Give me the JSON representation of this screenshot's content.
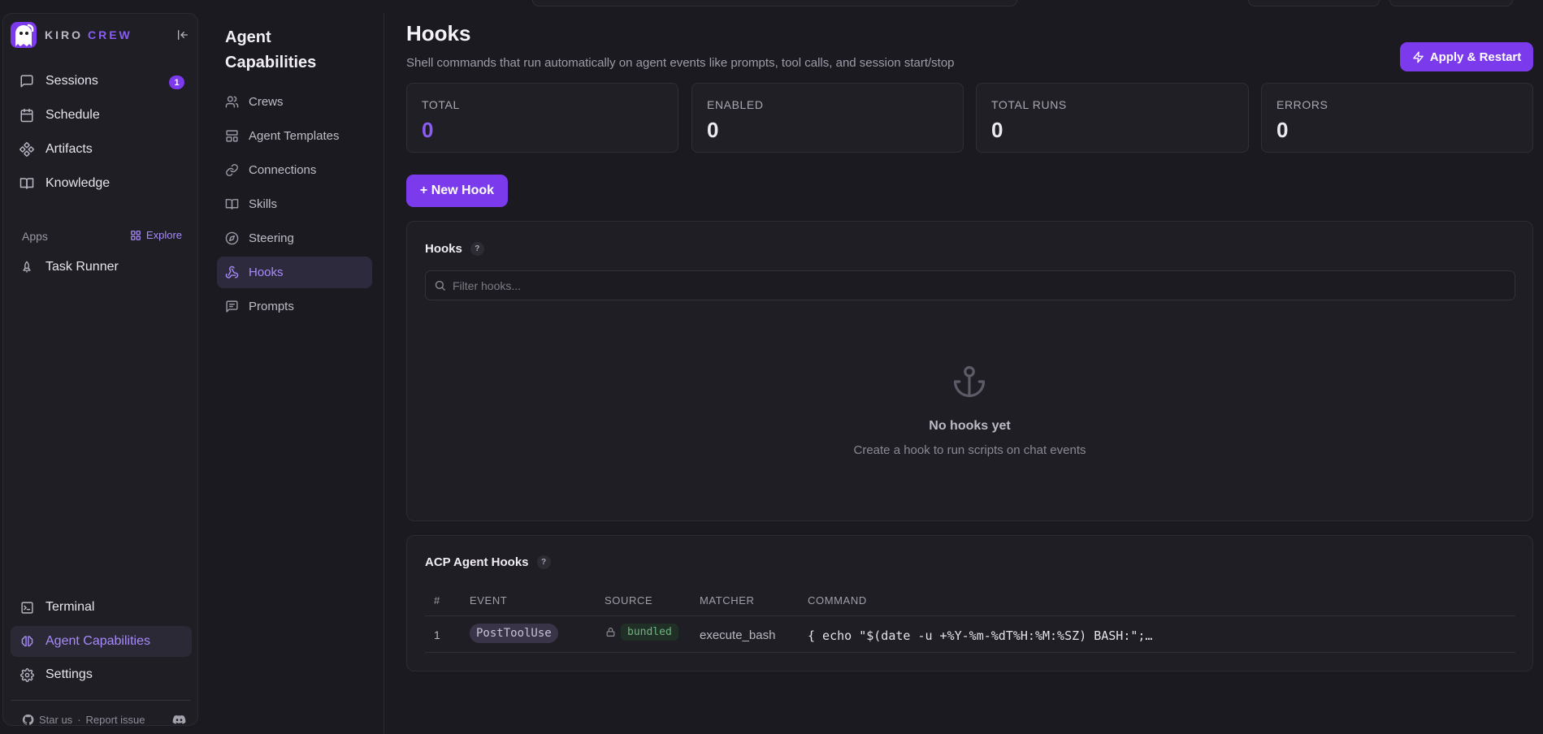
{
  "brand": {
    "word1": "KIRO",
    "word2": "CREW"
  },
  "sidebar": {
    "items": [
      {
        "label": "Sessions",
        "badge": "1"
      },
      {
        "label": "Schedule"
      },
      {
        "label": "Artifacts"
      },
      {
        "label": "Knowledge"
      }
    ],
    "apps_label": "Apps",
    "explore_label": "Explore",
    "apps": [
      {
        "label": "Task Runner"
      }
    ],
    "bottom": [
      {
        "label": "Terminal"
      },
      {
        "label": "Agent Capabilities"
      },
      {
        "label": "Settings"
      }
    ],
    "footer": {
      "star": "Star us",
      "separator": "·",
      "report": "Report issue"
    }
  },
  "capabilities": {
    "title": "Agent Capabilities",
    "items": [
      {
        "label": "Crews"
      },
      {
        "label": "Agent Templates"
      },
      {
        "label": "Connections"
      },
      {
        "label": "Skills"
      },
      {
        "label": "Steering"
      },
      {
        "label": "Hooks"
      },
      {
        "label": "Prompts"
      }
    ]
  },
  "header": {
    "title": "Hooks",
    "subtitle": "Shell commands that run automatically on agent events like prompts, tool calls, and session start/stop",
    "apply_label": "Apply & Restart"
  },
  "stats": [
    {
      "label": "TOTAL",
      "value": "0"
    },
    {
      "label": "ENABLED",
      "value": "0"
    },
    {
      "label": "TOTAL RUNS",
      "value": "0"
    },
    {
      "label": "ERRORS",
      "value": "0"
    }
  ],
  "new_hook_label": "+ New Hook",
  "hooks_panel": {
    "title": "Hooks",
    "help": "?",
    "filter_placeholder": "Filter hooks...",
    "empty_title": "No hooks yet",
    "empty_subtitle": "Create a hook to run scripts on chat events"
  },
  "acp_panel": {
    "title": "ACP Agent Hooks",
    "help": "?",
    "columns": [
      "#",
      "EVENT",
      "SOURCE",
      "MATCHER",
      "COMMAND"
    ],
    "rows": [
      {
        "num": "1",
        "event": "PostToolUse",
        "source": "bundled",
        "matcher": "execute_bash",
        "command": "{ echo \"$(date -u +%Y-%m-%dT%H:%M:%SZ) BASH:\";…"
      }
    ]
  },
  "colors": {
    "accent": "#7c3aed",
    "accent_text": "#a78bfa",
    "background": "#1b1a20",
    "source_green": "#6fb47f"
  },
  "icons": {
    "sidebar": [
      "chat-bubble-icon",
      "calendar-icon",
      "artifacts-icon",
      "book-icon",
      "rocket-icon",
      "terminal-icon",
      "brain-icon",
      "gear-icon"
    ],
    "capabilities": [
      "users-icon",
      "template-icon",
      "link-icon",
      "book-icon",
      "compass-icon",
      "webhook-icon",
      "message-square-icon"
    ],
    "misc": [
      "collapse-sidebar-icon",
      "grid-icon",
      "github-icon",
      "discord-icon",
      "zap-icon",
      "search-icon",
      "anchor-icon",
      "lock-icon"
    ]
  }
}
